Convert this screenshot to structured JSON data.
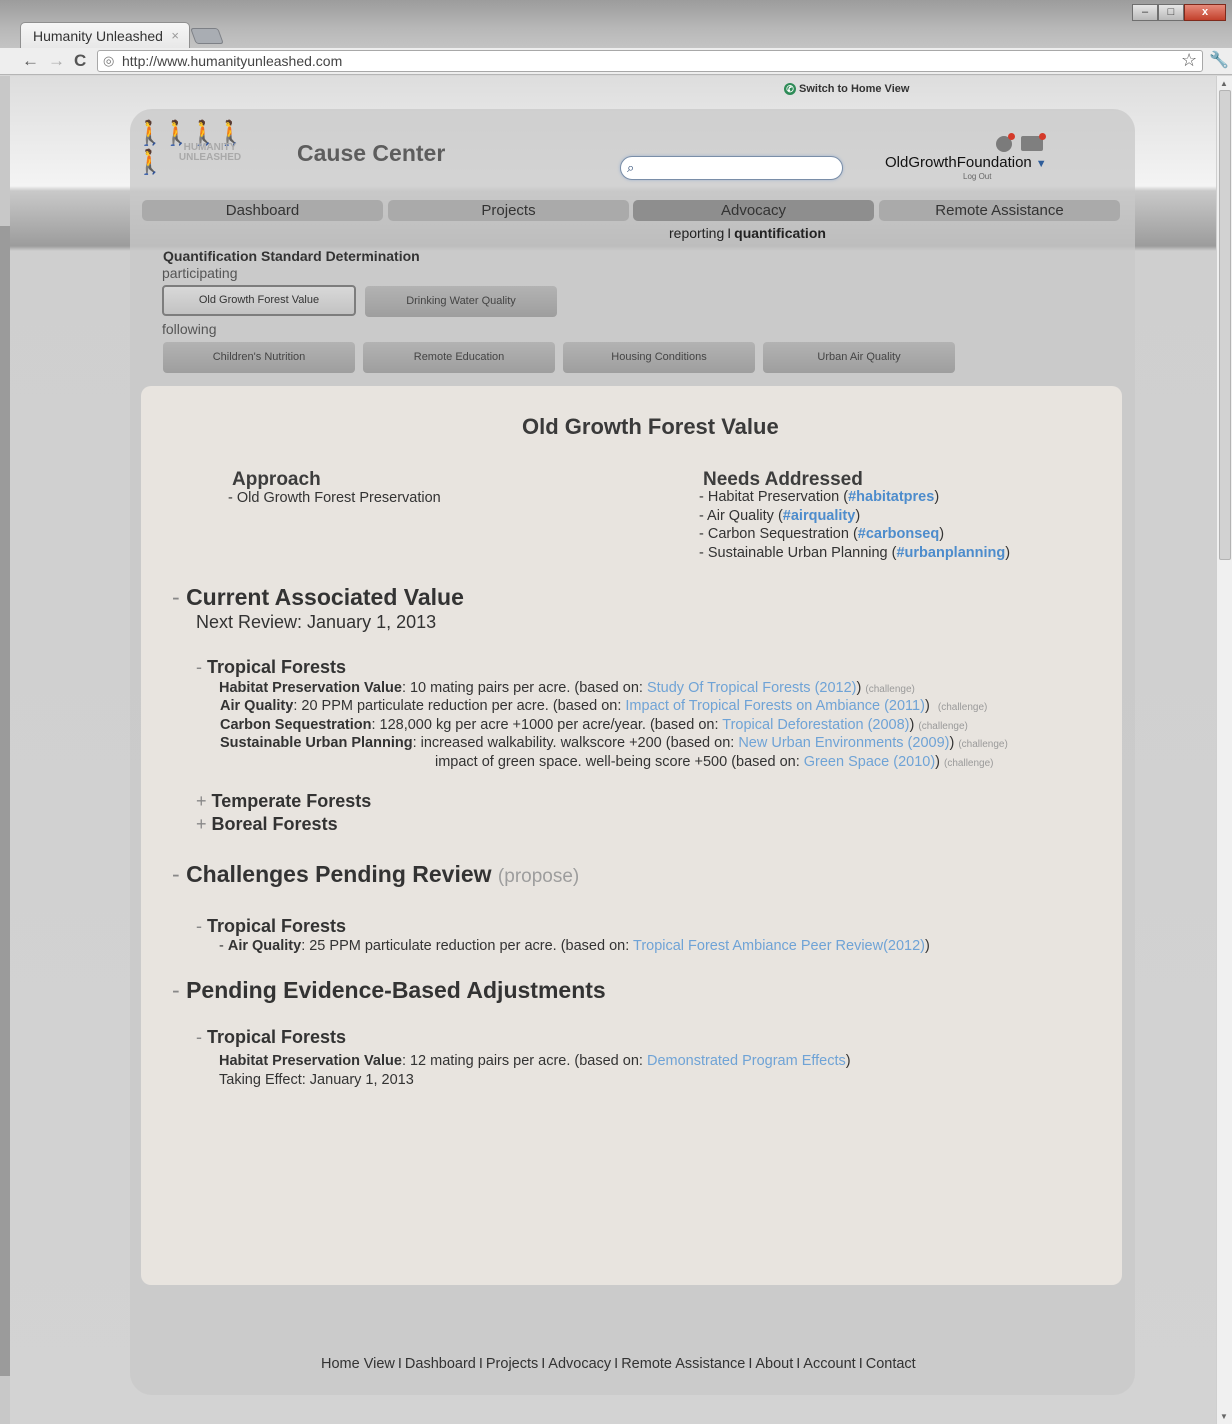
{
  "browser": {
    "tab_title": "Humanity Unleashed",
    "tab_close": "×",
    "url": "http://www.humanityunleashed.com",
    "win_min": "–",
    "win_max": "□",
    "win_close": "x"
  },
  "topbar": {
    "switch_home": "Switch to Home View"
  },
  "header": {
    "logo_text": "HUMANITY UNLEASHED",
    "title": "Cause Center",
    "search_value": "",
    "account": "OldGrowthFoundation",
    "logout": "Log Out"
  },
  "nav": {
    "tabs": [
      {
        "label": "Dashboard"
      },
      {
        "label": "Projects"
      },
      {
        "label": "Advocacy"
      },
      {
        "label": "Remote Assistance"
      }
    ],
    "sub": {
      "reporting": "reporting",
      "sep": "I",
      "quantification": "quantification"
    }
  },
  "qsd": {
    "title": "Quantification Standard Determination",
    "participating_label": "participating",
    "following_label": "following",
    "participating": [
      "Old Growth Forest Value",
      "Drinking Water Quality"
    ],
    "following": [
      "Children's Nutrition",
      "Remote Education",
      "Housing Conditions",
      "Urban Air Quality"
    ]
  },
  "content": {
    "title": "Old Growth Forest Value",
    "approach_heading": "Approach",
    "approach_item": "- Old Growth Forest Preservation",
    "needs_heading": "Needs Addressed",
    "needs": [
      {
        "pre": "- Habitat Preservation (",
        "tag": "#habitatpres",
        "post": ")"
      },
      {
        "pre": "- Air Quality (",
        "tag": "#airquality",
        "post": ")"
      },
      {
        "pre": "- Carbon Sequestration (",
        "tag": "#carbonseq",
        "post": ")"
      },
      {
        "pre": "- Sustainable Urban Planning (",
        "tag": "#urbanplanning",
        "post": ")"
      }
    ],
    "current": {
      "dash": "-",
      "heading": "Current Associated Value",
      "next_review": "Next Review: January 1, 2013",
      "tropical_heading": "Tropical Forests",
      "rows": [
        {
          "label": "Habitat Preservation Value",
          "text": ": 10 mating pairs per acre. (based on: ",
          "link": "Study Of Tropical Forests (2012)",
          "close": ")",
          "challenge": "(challenge)"
        },
        {
          "label": "Air Quality",
          "text": ":  20 PPM particulate reduction per acre. (based on: ",
          "link": "Impact of Tropical Forests on Ambiance (2011)",
          "close": ")",
          "challenge": "(challenge)"
        },
        {
          "label": "Carbon Sequestration",
          "text": ":  128,000 kg per acre +1000 per acre/year. (based on: ",
          "link": "Tropical Deforestation (2008)",
          "close": ")",
          "challenge": "(challenge)"
        },
        {
          "label": "Sustainable Urban Planning",
          "text": ":  increased walkability. walkscore +200 (based on: ",
          "link": "New Urban Environments (2009)",
          "close": ")",
          "challenge": "(challenge)"
        }
      ],
      "extra_row": {
        "text": "impact of green space. well-being score +500 (based on: ",
        "link": "Green Space (2010)",
        "close": ")",
        "challenge": "(challenge)"
      },
      "collapsed": [
        "Temperate Forests",
        "Boreal Forests"
      ]
    },
    "challenges": {
      "heading": "Challenges Pending Review",
      "propose": "(propose)",
      "tropical_heading": "Tropical Forests",
      "row": {
        "pre": "- ",
        "label": "Air Quality",
        "text": ":  25 PPM particulate reduction per acre. (based on: ",
        "link": "Tropical Forest Ambiance Peer Review(2012)",
        "close": ")"
      }
    },
    "adjustments": {
      "heading": "Pending Evidence-Based Adjustments",
      "tropical_heading": "Tropical Forests",
      "row": {
        "label": "Habitat Preservation Value",
        "text": ": 12 mating pairs per acre. (based on: ",
        "link": "Demonstrated Program Effects",
        "close": ")"
      },
      "effect": "Taking Effect: January 1, 2013"
    }
  },
  "footer": {
    "links": [
      "Home View",
      "Dashboard",
      "Projects",
      "Advocacy",
      "Remote Assistance",
      "About",
      "Account",
      "Contact"
    ],
    "sep": "I"
  },
  "colors": {
    "link": "#6fa3d6",
    "hashtag": "#4d8ccc",
    "card_bg": "#e8e4df"
  }
}
